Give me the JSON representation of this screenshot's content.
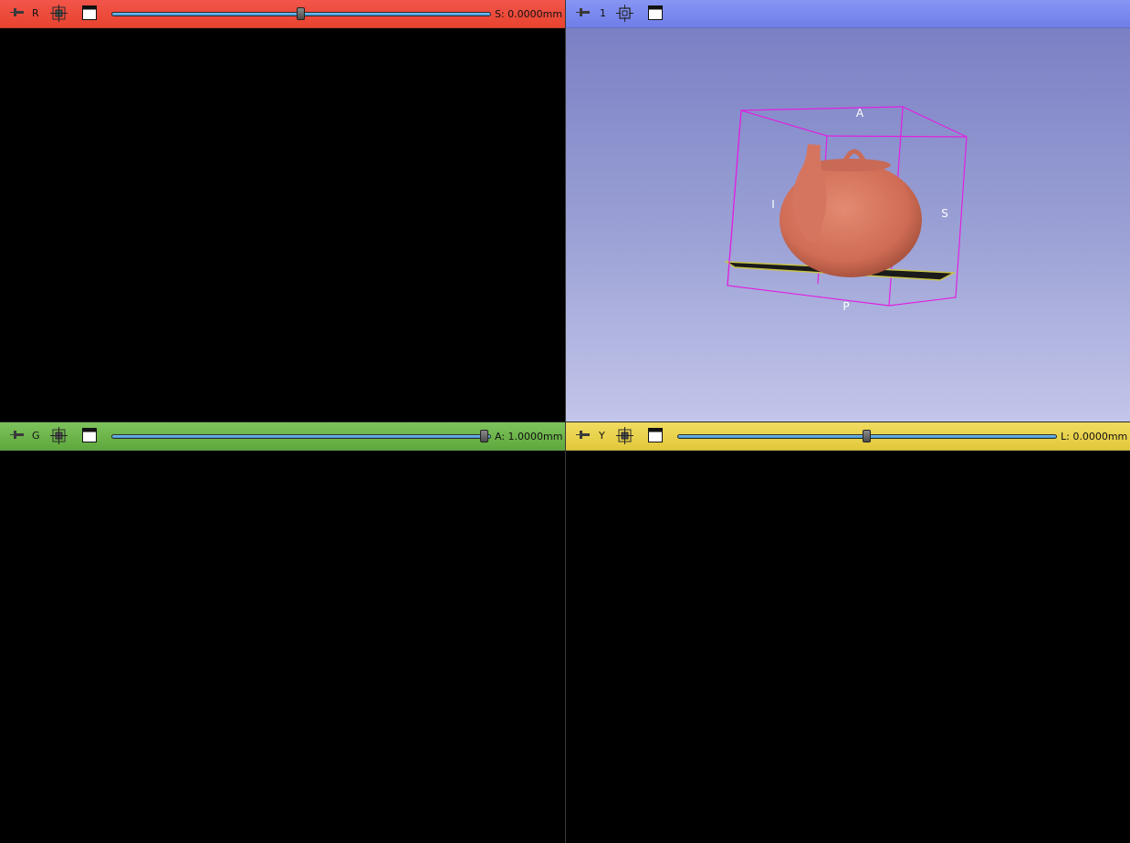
{
  "viewers": {
    "red": {
      "label": "R",
      "offset_text": "S: 0.0000mm",
      "slider_position": 0.5,
      "color": "#e8432f"
    },
    "three_d": {
      "label": "1",
      "color": "#6f7ee9",
      "orientation": {
        "top": "A",
        "bottom": "P",
        "left": "I",
        "right": "S"
      }
    },
    "green": {
      "label": "G",
      "offset_text": "A: 1.0000mm",
      "slider_position": 1.0,
      "color": "#5ea83c"
    },
    "yellow": {
      "label": "Y",
      "offset_text": "L: 0.0000mm",
      "slider_position": 0.5,
      "color": "#e2c83a"
    }
  },
  "icons": {
    "pin": "pin-icon",
    "link": "link-icon",
    "center": "center-view-icon",
    "layout": "maximize-view-icon"
  },
  "scene": {
    "model": "teapot",
    "model_color": "#d57560",
    "bbox_color": "#e020e0"
  }
}
